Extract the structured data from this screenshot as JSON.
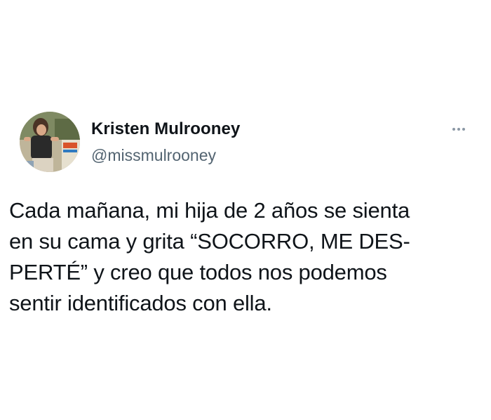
{
  "tweet": {
    "author": {
      "display_name": "Kristen Mulrooney",
      "handle": "@missmulrooney",
      "avatar_icon": "profile-photo"
    },
    "more_icon": "ellipsis-icon",
    "text_lines": [
      "Cada mañana, mi hija de 2 años se sienta",
      "en su cama y grita “SOCORRO, ME DES-",
      "PERTÉ”  y creo que todos nos podemos",
      "sentir identificados con ella."
    ]
  },
  "colors": {
    "text_primary": "#0f1419",
    "text_secondary": "#536471",
    "background": "#ffffff"
  }
}
